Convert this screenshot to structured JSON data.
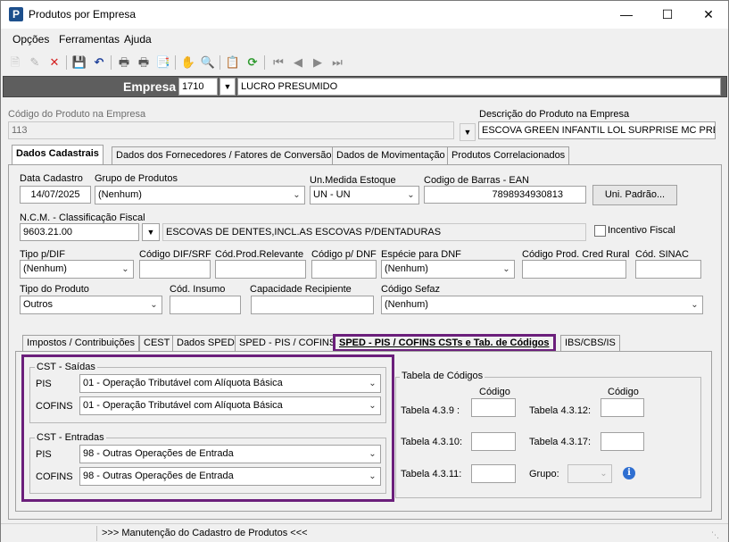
{
  "window": {
    "title": "Produtos por Empresa",
    "icon_letter": "P"
  },
  "menu": [
    "Opções",
    "Ferramentas",
    "Ajuda"
  ],
  "empresa": {
    "label": "Empresa",
    "code": "1710",
    "name": "LUCRO PRESUMIDO"
  },
  "produto": {
    "codigo_label": "Código do Produto na Empresa",
    "codigo_value": "113",
    "descricao_label": "Descrição do Produto na Empresa",
    "descricao_value": "ESCOVA GREEN INFANTIL LOL SURPRISE MC PREDBC"
  },
  "tabs": [
    "Dados Cadastrais",
    "Dados dos Fornecedores / Fatores de Conversão",
    "Dados de Movimentação",
    "Produtos Correlacionados"
  ],
  "dados": {
    "data_cadastro_label": "Data Cadastro",
    "data_cadastro": "14/07/2025",
    "grupo_label": "Grupo de Produtos",
    "grupo": "(Nenhum)",
    "un_label": "Un.Medida Estoque",
    "un": "UN - UN",
    "ean_label": "Codigo de Barras - EAN",
    "ean": "7898934930813",
    "uni_padrao_btn": "Uni. Padrão...",
    "ncm_label": "N.C.M. -  Classificação Fiscal",
    "ncm": "9603.21.00",
    "ncm_desc": "ESCOVAS DE DENTES,INCL.AS ESCOVAS P/DENTADURAS",
    "incentivo_label": "Incentivo Fiscal",
    "tipo_dif_label": "Tipo p/DIF",
    "tipo_dif": "(Nenhum)",
    "cod_dif_label": "Código DIF/SRF",
    "cod_prod_relev_label": "Cód.Prod.Relevante",
    "cod_dnf_label": "Código p/ DNF",
    "especie_dnf_label": "Espécie para DNF",
    "especie_dnf": "(Nenhum)",
    "cod_cred_rural_label": "Código Prod. Cred Rural",
    "cod_sinac_label": "Cód. SINAC",
    "tipo_produto_label": "Tipo do Produto",
    "tipo_produto": "Outros",
    "cod_insumo_label": "Cód. Insumo",
    "capacidade_label": "Capacidade Recipiente",
    "cod_sefaz_label": "Código Sefaz",
    "cod_sefaz": "(Nenhum)"
  },
  "subtabs": [
    "Impostos / Contribuições",
    "CEST",
    "Dados SPED",
    "SPED - PIS / COFINS",
    "SPED - PIS / COFINS CSTs e Tab. de Códigos",
    "IBS/CBS/IS"
  ],
  "cst": {
    "saidas_title": "CST - Saídas",
    "entradas_title": "CST - Entradas",
    "pis_label": "PIS",
    "cofins_label": "COFINS",
    "saida_pis": "01 - Operação Tributável com Alíquota Básica",
    "saida_cofins": "01 - Operação Tributável com Alíquota Básica",
    "entrada_pis": "98 - Outras Operações de Entrada",
    "entrada_cofins": "98 - Outras Operações de Entrada"
  },
  "tabela": {
    "title": "Tabela de Códigos",
    "codigo_header": "Código",
    "t439": "Tabela 4.3.9 :",
    "t4312": "Tabela 4.3.12:",
    "t4310": "Tabela 4.3.10:",
    "t4317": "Tabela 4.3.17:",
    "t4311": "Tabela 4.3.11:",
    "grupo": "Grupo:"
  },
  "status": {
    "text": ">>> Manutenção do Cadastro de Produtos <<<"
  }
}
